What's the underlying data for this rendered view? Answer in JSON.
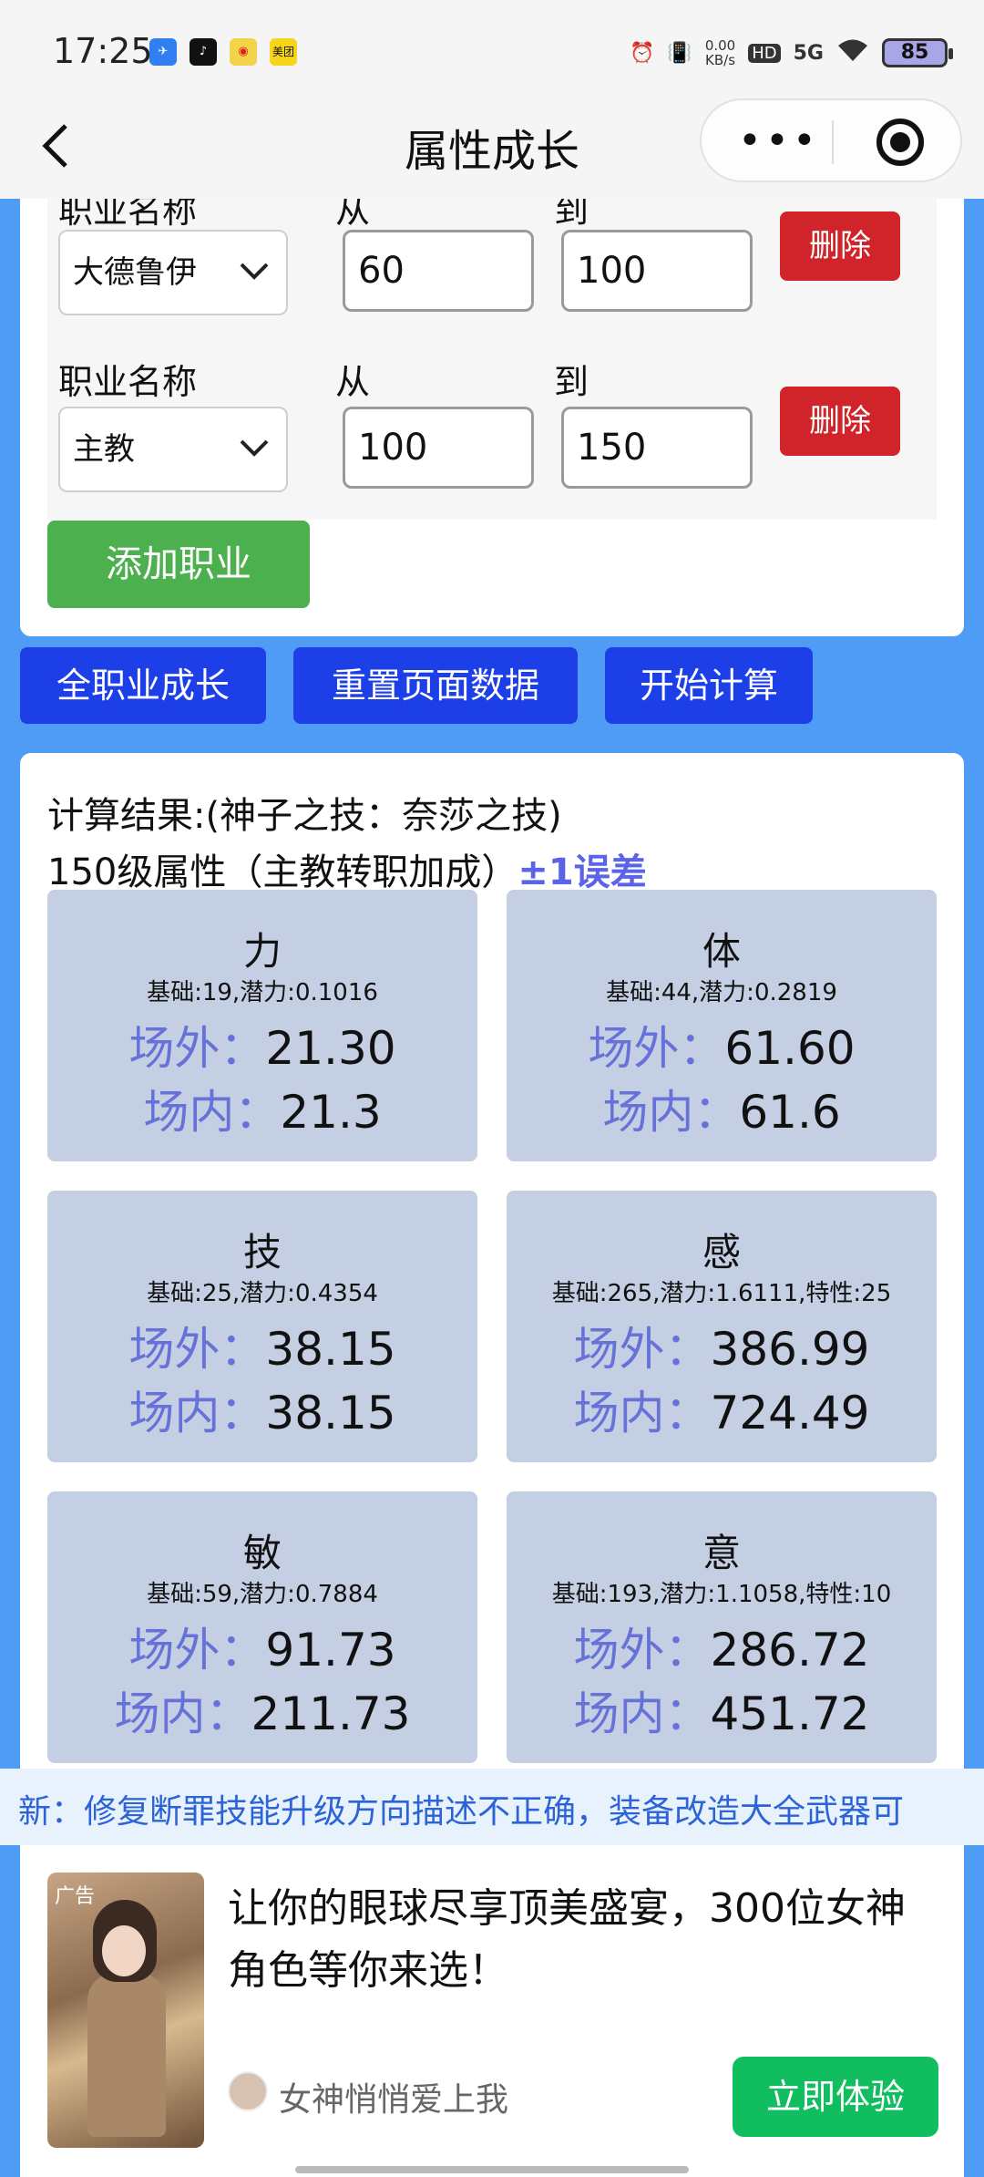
{
  "status_bar": {
    "time": "17:25",
    "apps": [
      {
        "icon": "app-blue-icon",
        "color": "#2f7ff0",
        "text": ""
      },
      {
        "icon": "tiktok-icon",
        "color": "#111111",
        "text": ""
      },
      {
        "icon": "weibo-icon",
        "color": "#f3d34a",
        "text": ""
      },
      {
        "icon": "meituan-icon",
        "color": "#f7d51a",
        "text": "美团"
      }
    ],
    "net_speed": "0.00\nKB/s",
    "hd": "HD",
    "signal": "5G",
    "battery": "85"
  },
  "nav": {
    "title": "属性成长",
    "back": "‹",
    "more": "•••"
  },
  "jobs": [
    {
      "label": "职业名称",
      "from_label": "从",
      "to_label": "到",
      "job": "大德鲁伊",
      "from": "60",
      "to": "100",
      "delete": "删除"
    },
    {
      "label": "职业名称",
      "from_label": "从",
      "to_label": "到",
      "job": "主教",
      "from": "100",
      "to": "150",
      "delete": "删除"
    }
  ],
  "add_job": "添加职业",
  "actions": {
    "all_growth": "全职业成长",
    "reset": "重置页面数据",
    "calculate": "开始计算"
  },
  "result": {
    "line1": "计算结果:(神子之技：奈莎之技)",
    "line2_prefix": "150级属性（主教转职加成）",
    "error": "±1误差",
    "outside_label": "场外：",
    "inside_label": "场内：",
    "stats": [
      {
        "name": "力",
        "base": "基础:19,潜力:0.1016",
        "outside": "21.30",
        "inside": "21.3"
      },
      {
        "name": "体",
        "base": "基础:44,潜力:0.2819",
        "outside": "61.60",
        "inside": "61.6"
      },
      {
        "name": "技",
        "base": "基础:25,潜力:0.4354",
        "outside": "38.15",
        "inside": "38.15"
      },
      {
        "name": "感",
        "base": "基础:265,潜力:1.6111,特性:25",
        "outside": "386.99",
        "inside": "724.49"
      },
      {
        "name": "敏",
        "base": "基础:59,潜力:0.7884",
        "outside": "91.73",
        "inside": "211.73"
      },
      {
        "name": "意",
        "base": "基础:193,潜力:1.1058,特性:10",
        "outside": "286.72",
        "inside": "451.72"
      }
    ]
  },
  "ticker": "新：修复断罪技能升级方向描述不正确，装备改造大全武器可",
  "ad": {
    "tag": "广告",
    "text": "让你的眼球尽享顶美盛宴，300位女神角色等你来选！",
    "name": "女神悄悄爱上我",
    "cta": "立即体验"
  }
}
